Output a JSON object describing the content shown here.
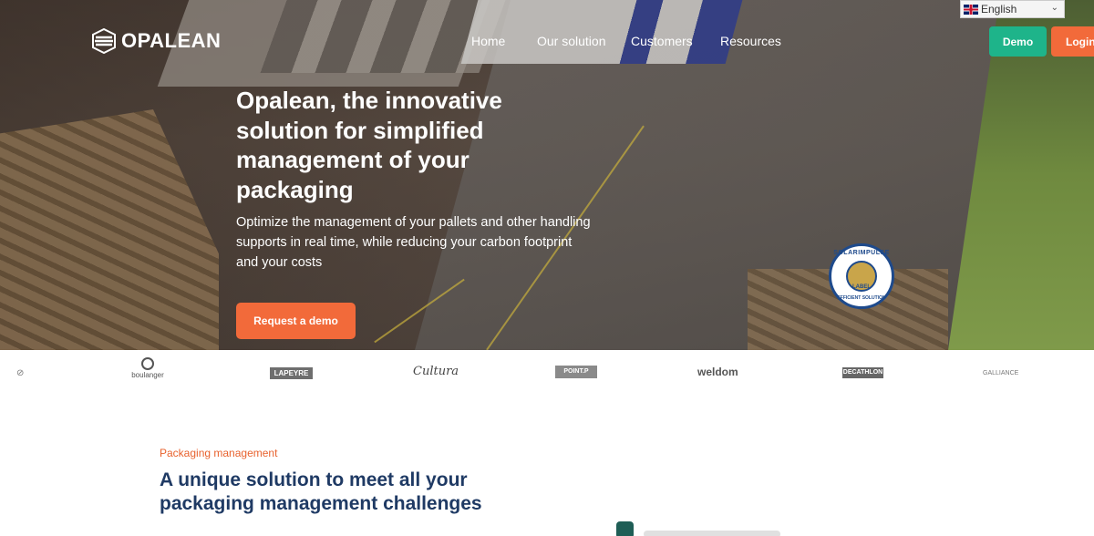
{
  "brand": {
    "name": "OPALEAN"
  },
  "nav": {
    "items": [
      "Home",
      "Our solution",
      "Customers",
      "Resources"
    ]
  },
  "language": {
    "selected": "English"
  },
  "actions": {
    "demo_label": "Demo",
    "login_label": "Login"
  },
  "hero": {
    "title": "Opalean, the innovative solution for simplified management of your packaging",
    "subtitle": "Optimize the management of your pallets and other handling supports in real time, while reducing your carbon footprint and your costs",
    "cta_label": "Request a demo"
  },
  "badge": {
    "top_text": "SOLARIMPULSE",
    "center_text": "LABEL",
    "bottom_text": "EFFICIENT SOLUTION"
  },
  "clients": [
    "boulanger",
    "LAPEYRE",
    "Cultura",
    "POINT.P",
    "weldom",
    "DECATHLON",
    "GALLIANCE"
  ],
  "section": {
    "eyebrow": "Packaging management",
    "title": "A unique solution to meet all your packaging management challenges"
  },
  "colors": {
    "accent_orange": "#f26a3a",
    "accent_green": "#1eb48a",
    "title_navy": "#1f3a64"
  }
}
